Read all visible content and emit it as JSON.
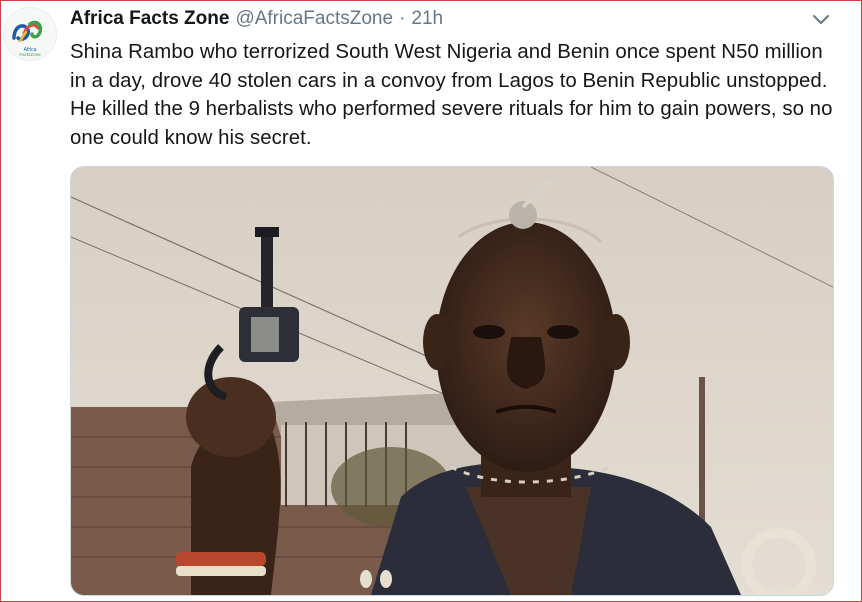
{
  "tweet": {
    "display_name": "Africa Facts Zone",
    "handle": "@AfricaFactsZone",
    "separator": "·",
    "time": "21h",
    "text": "Shina Rambo who terrorized South West Nigeria and Benin once spent N50 million in a day, drove 40 stolen cars in a convoy from Lagos to Benin Republic unstopped. He killed the 9 herbalists who performed severe rituals for him to gain powers, so no one could know his secret.",
    "avatar_logo_text": "Africa FactsZone",
    "more_icon": "chevron-down-icon",
    "media_subject": "photo"
  },
  "colors": {
    "text": "#14171a",
    "muted": "#657786",
    "border": "#ccd6dd",
    "frame_border": "#c8454a",
    "logo_blue": "#1c5fa8",
    "logo_green": "#3aa34a"
  }
}
